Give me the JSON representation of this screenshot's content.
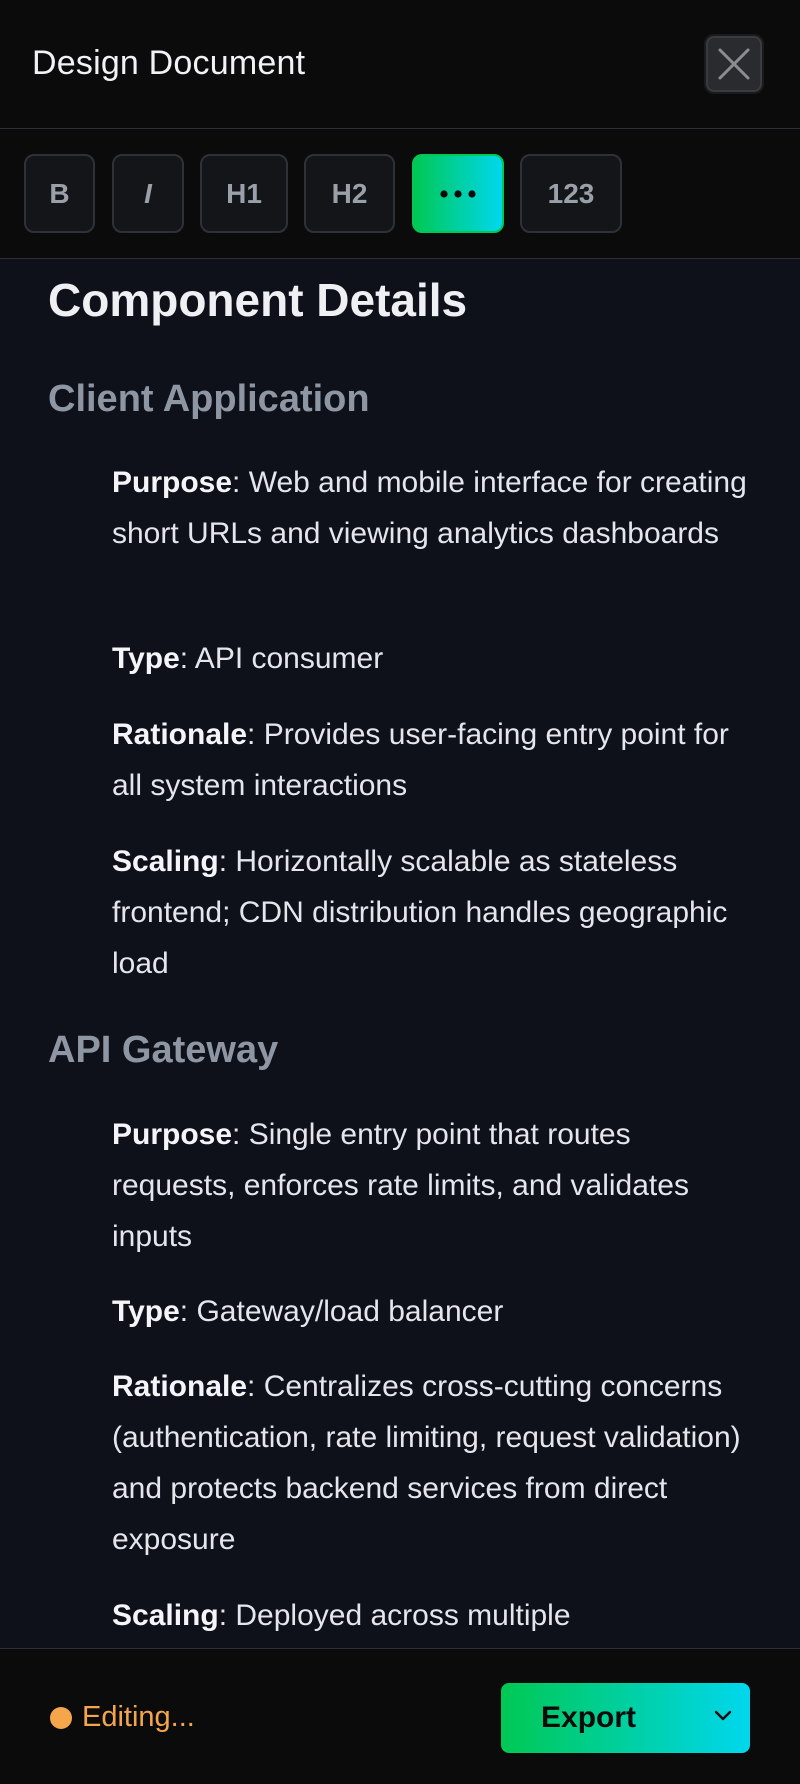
{
  "header": {
    "title": "Design Document",
    "close_icon": "close-icon"
  },
  "toolbar": {
    "buttons": [
      {
        "label": "B",
        "name": "bold"
      },
      {
        "label": "I",
        "name": "italic"
      },
      {
        "label": "H1",
        "name": "heading-1"
      },
      {
        "label": "H2",
        "name": "heading-2"
      },
      {
        "label": "•••",
        "name": "bullet-list",
        "active": true
      },
      {
        "label": "123",
        "name": "numbered-list"
      }
    ]
  },
  "document": {
    "heading": "Component Details",
    "sections": [
      {
        "title": "Client Application",
        "items": [
          {
            "key": "Purpose",
            "text": ": Web and mobile interface for creating short URLs and viewing analytics dashboards"
          },
          {
            "key": "Type",
            "text": ": API consumer"
          },
          {
            "key": "Rationale",
            "text": ": Provides user-facing entry point for all system interactions"
          },
          {
            "key": "Scaling",
            "text": ": Horizontally scalable as stateless frontend; CDN distribution handles geographic load"
          }
        ]
      },
      {
        "title": "API Gateway",
        "items": [
          {
            "key": "Purpose",
            "text": ": Single entry point that routes requests, enforces rate limits, and validates inputs"
          },
          {
            "key": "Type",
            "text": ": Gateway/load balancer"
          },
          {
            "key": "Rationale",
            "text": ": Centralizes cross-cutting concerns (authentication, rate limiting, request validation) and protects backend services from direct exposure"
          },
          {
            "key": "Scaling",
            "text": ": Deployed across multiple"
          }
        ]
      }
    ]
  },
  "footer": {
    "status": "Editing...",
    "export_label": "Export"
  },
  "colors": {
    "accent_start": "#00c853",
    "accent_end": "#00d7ee",
    "status": "#f5a54a"
  }
}
